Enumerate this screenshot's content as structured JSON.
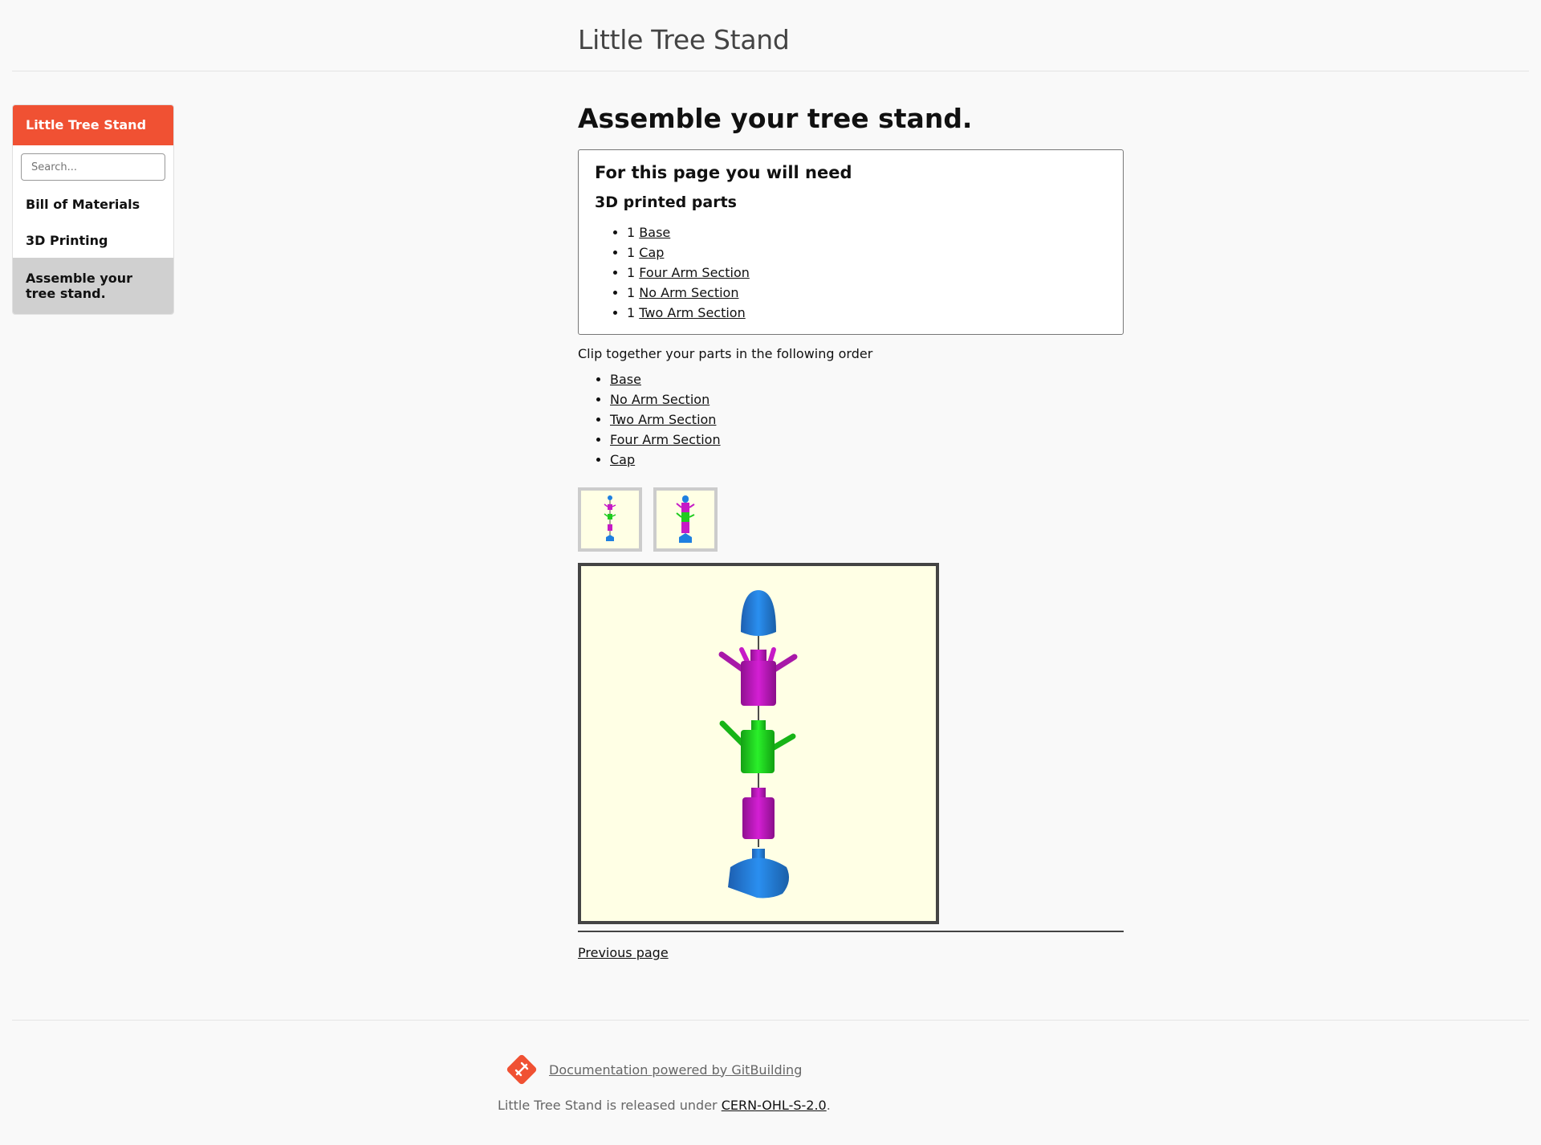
{
  "header": {
    "site_title": "Little Tree Stand"
  },
  "sidebar": {
    "title": "Little Tree Stand",
    "search_placeholder": "Search...",
    "items": [
      {
        "label": "Bill of Materials"
      },
      {
        "label": "3D Printing"
      },
      {
        "label": "Assemble your tree stand."
      }
    ]
  },
  "main": {
    "page_title": "Assemble your tree stand.",
    "need_box": {
      "title": "For this page you will need",
      "subtitle": "3D printed parts",
      "parts": [
        {
          "qty": "1",
          "name": "Base"
        },
        {
          "qty": "1",
          "name": "Cap"
        },
        {
          "qty": "1",
          "name": "Four Arm Section"
        },
        {
          "qty": "1",
          "name": "No Arm Section"
        },
        {
          "qty": "1",
          "name": "Two Arm Section"
        }
      ]
    },
    "clip_text": "Clip together your parts in the following order",
    "order": [
      "Base",
      "No Arm Section",
      "Two Arm Section",
      "Four Arm Section",
      "Cap"
    ],
    "previous_label": "Previous page"
  },
  "colors": {
    "accent": "#f05133",
    "part_blue": "#1e7fe0",
    "part_magenta": "#c61ac6",
    "part_green": "#1fcc1f",
    "viewer_bg": "#ffffe5"
  },
  "footer": {
    "powered_label": "Documentation powered by GitBuilding",
    "license_prefix": "Little Tree Stand is released under ",
    "license_link": "CERN-OHL-S-2.0",
    "license_suffix": "."
  }
}
